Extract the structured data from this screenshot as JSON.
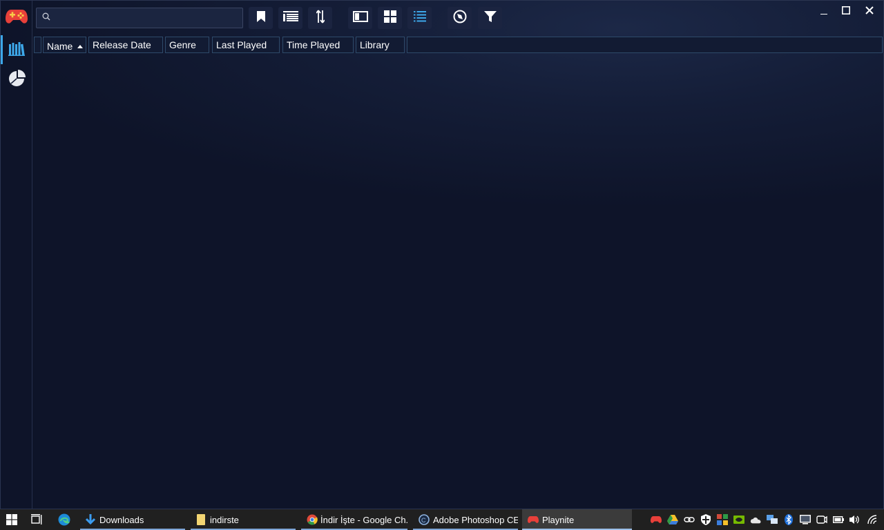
{
  "search": {
    "value": "",
    "placeholder": ""
  },
  "columns": [
    {
      "label": ""
    },
    {
      "label": "Name",
      "sort": "asc"
    },
    {
      "label": "Release Date"
    },
    {
      "label": "Genre"
    },
    {
      "label": "Last Played"
    },
    {
      "label": "Time Played"
    },
    {
      "label": "Library"
    },
    {
      "label": ""
    }
  ],
  "sidebar": {
    "items": [
      {
        "icon": "library-icon",
        "active": true
      },
      {
        "icon": "statistics-icon",
        "active": false
      }
    ]
  },
  "toolbar": {
    "buttons": [
      "bookmark-icon",
      "group-list-icon",
      "sort-icon",
      "sidebar-panel-icon",
      "grid-view-icon",
      "list-view-icon",
      "explore-icon",
      "filter-icon"
    ]
  },
  "window": {
    "controls": [
      "minimize",
      "maximize",
      "close"
    ]
  },
  "taskbar": {
    "apps": [
      {
        "label": "Downloads",
        "icon": "download-arrow-icon"
      },
      {
        "label": "indirste",
        "icon": "folder-icon"
      },
      {
        "label": "İndir İşte - Google Ch...",
        "icon": "chrome-icon"
      },
      {
        "label": "Adobe Photoshop CE",
        "icon": "photoshop-icon"
      },
      {
        "label": "Playnite",
        "icon": "gamepad-icon",
        "active": true
      }
    ]
  },
  "colors": {
    "accent": "#3da8ea",
    "logo": "#e8403a",
    "background": "#0d1325"
  }
}
